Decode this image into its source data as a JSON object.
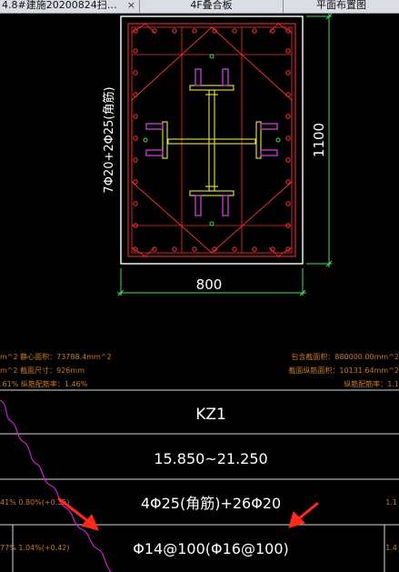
{
  "tabs": [
    {
      "label": "4.8#建施20200824扫…",
      "close": "×",
      "active": false
    },
    {
      "label": "4F叠合板",
      "active": false
    },
    {
      "label": "平面布置图",
      "active": false
    }
  ],
  "drawing": {
    "width_dim": "800",
    "height_dim": "1100",
    "rebar_side_label": "7Φ20+2Φ25(角筋)"
  },
  "left_annotations": [
    "m^2 静心面积：73788.4mm^2",
    "m^2 截面尺寸：926mm",
    ".61% 纵筋配筋率：1.46%"
  ],
  "right_annotations": [
    "包含截面积：880000.00mm^2",
    "截面纵筋面积：10131.64mm^2",
    "纵筋配筋率：1.1"
  ],
  "table": {
    "name": "KZ1",
    "elevation": "15.850~21.250",
    "longitudinal": "4Φ25(角筋)+26Φ20",
    "stirrup": "Φ14@100(Φ16@100)",
    "left_ratio_1": "41% 0.80%(+0.35)",
    "left_ratio_2": "77% 1.04%(+0.42)",
    "right_ratio_1": "1.1",
    "right_ratio_2": "1.4"
  },
  "colors": {
    "background": "#000000",
    "outline": "#ffffff",
    "rebar": "#ff3030",
    "steel": "#e8e840",
    "bolt": "#d040d0",
    "dimension": "#40e060",
    "annotation": "#c87a2a",
    "arrow": "#ff2a1a",
    "wave": "#d020d0"
  }
}
